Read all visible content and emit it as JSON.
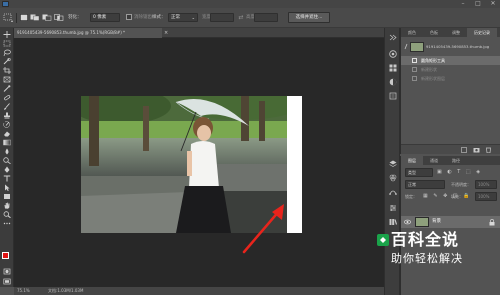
{
  "window": {
    "minimize_glyph": "–",
    "maximize_glyph": "□",
    "close_glyph": "✕"
  },
  "options_bar": {
    "feather_label": "羽化：",
    "feather_value": "0 像素",
    "antialias_label": "消除锯齿",
    "style_label": "样式：",
    "style_value": "正常",
    "width_label": "宽度：",
    "height_label": "高度：",
    "select_mask_button": "选择并遮住..."
  },
  "document": {
    "tab_title": "9191405439-5690853.thumb.jpg @ 75.1%(RGB/8#) *",
    "tab_close": "×",
    "zoom_status": "75.1%",
    "doc_status": "文档:1.03M/1.03M"
  },
  "history_panel": {
    "tabs": [
      "颜色",
      "色板",
      "调整",
      "历史记录"
    ],
    "active_tab_index": 3,
    "snapshot_name": "9191405439-5690853.thumb.jpg",
    "items": [
      {
        "label": "圆角矩形工具",
        "state": "selected"
      },
      {
        "label": "新建形状",
        "state": "dimmed"
      },
      {
        "label": "新建形状图层",
        "state": "dimmed"
      }
    ]
  },
  "layers_panel": {
    "tab_label": "图层",
    "tabs": [
      "图层",
      "通道",
      "路径"
    ],
    "kind_label": "类型",
    "blend_mode": "正常",
    "opacity_label": "不透明度：",
    "opacity_value": "100%",
    "lock_label": "锁定：",
    "fill_label": "填充：",
    "fill_value": "100%",
    "layer_name": "背景"
  },
  "watermark": {
    "line1": "百科全说",
    "line2": "助你轻松解决"
  },
  "colors": {
    "foreground": "#e01414",
    "background": "#ffffff",
    "arrow": "#e8241c",
    "brand_green": "#1aa34a"
  }
}
